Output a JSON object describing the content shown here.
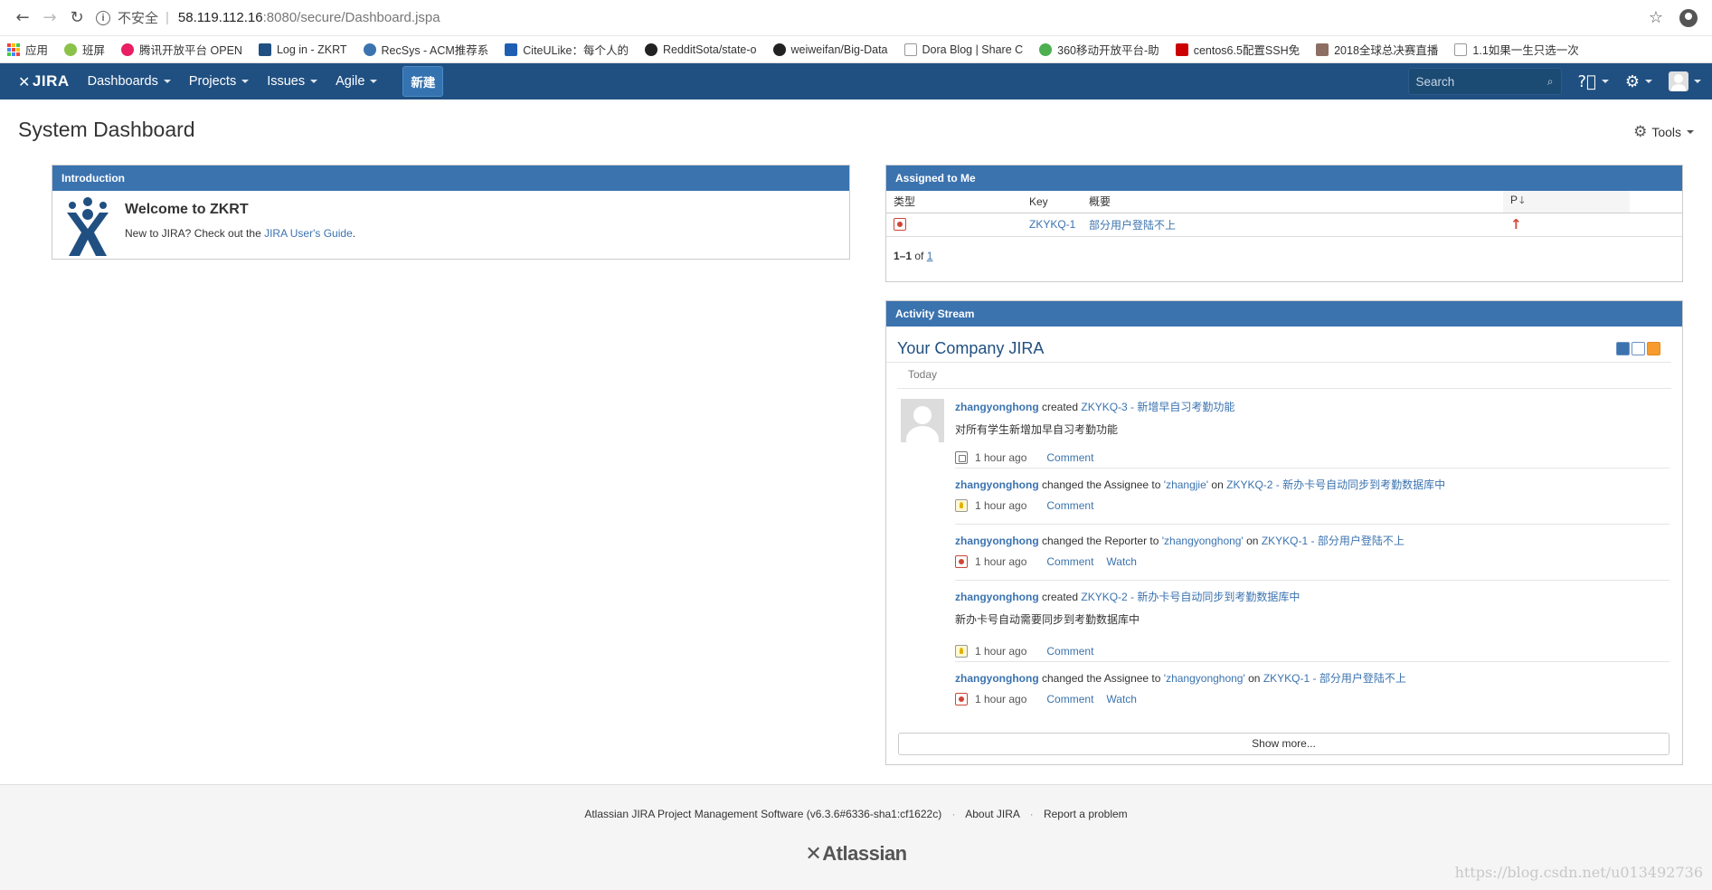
{
  "browser": {
    "insecure_label": "不安全",
    "separator": "|",
    "url_host": "58.119.112.16",
    "url_path": ":8080/secure/Dashboard.jspa",
    "bookmarks": [
      {
        "label": "应用",
        "color": "#e44"
      },
      {
        "label": "班屏",
        "color": "#8bc34a"
      },
      {
        "label": "腾讯开放平台 OPEN",
        "color": "#e91e63"
      },
      {
        "label": "Log in - ZKRT",
        "color": "#205081"
      },
      {
        "label": "RecSys - ACM推荐系",
        "color": "#3b73af"
      },
      {
        "label": "CiteULike：每个人的",
        "color": "#1e5fb4"
      },
      {
        "label": "RedditSota/state-o",
        "color": "#222"
      },
      {
        "label": "weiweifan/Big-Data",
        "color": "#222"
      },
      {
        "label": "Dora Blog | Share C",
        "color": "#999"
      },
      {
        "label": "360移动开放平台-助",
        "color": "#4caf50"
      },
      {
        "label": "centos6.5配置SSH免",
        "color": "#c00"
      },
      {
        "label": "2018全球总决赛直播",
        "color": "#8d6e63"
      },
      {
        "label": "1.1如果一生只选一次",
        "color": "#999"
      }
    ]
  },
  "header": {
    "logo": "JIRA",
    "nav": [
      "Dashboards",
      "Projects",
      "Issues",
      "Agile"
    ],
    "create_label": "新建",
    "search_placeholder": "Search"
  },
  "page": {
    "title": "System Dashboard",
    "tools_label": "Tools"
  },
  "introduction": {
    "title": "Introduction",
    "heading": "Welcome to ZKRT",
    "text_prefix": "New to JIRA? Check out the ",
    "link": "JIRA User's Guide",
    "text_suffix": "."
  },
  "assigned": {
    "title": "Assigned to Me",
    "columns": {
      "type": "类型",
      "key": "Key",
      "summary": "概要",
      "priority": "P"
    },
    "rows": [
      {
        "key": "ZKYKQ-1",
        "summary": "部分用户登陆不上"
      }
    ],
    "pager_range": "1–1",
    "pager_of": "of",
    "pager_page": "1"
  },
  "activity": {
    "title": "Activity Stream",
    "stream_heading": "Your Company JIRA",
    "today": "Today",
    "entries": [
      {
        "user": "zhangyonghong",
        "action": "created",
        "target": "ZKYKQ-3 - 新增早自习考勤功能",
        "description": "对所有学生新增加早自习考勤功能",
        "time": "1 hour ago",
        "comment": "Comment"
      },
      {
        "user": "zhangyonghong",
        "action": "changed the Assignee to",
        "value": "'zhangjie'",
        "on": "on",
        "target": "ZKYKQ-2 - 新办卡号自动同步到考勤数据库中",
        "time": "1 hour ago",
        "comment": "Comment"
      },
      {
        "user": "zhangyonghong",
        "action": "changed the Reporter to",
        "value": "'zhangyonghong'",
        "on": "on",
        "target": "ZKYKQ-1 - 部分用户登陆不上",
        "time": "1 hour ago",
        "comment": "Comment",
        "watch": "Watch"
      },
      {
        "user": "zhangyonghong",
        "action": "created",
        "target": "ZKYKQ-2 - 新办卡号自动同步到考勤数据库中",
        "description": "新办卡号自动需要同步到考勤数据库中",
        "time": "1 hour ago",
        "comment": "Comment"
      },
      {
        "user": "zhangyonghong",
        "action": "changed the Assignee to",
        "value": "'zhangyonghong'",
        "on": "on",
        "target": "ZKYKQ-1 - 部分用户登陆不上",
        "time": "1 hour ago",
        "comment": "Comment",
        "watch": "Watch"
      }
    ],
    "show_more": "Show more..."
  },
  "footer": {
    "software": "Atlassian JIRA Project Management Software (v6.3.6#6336-sha1:cf1622c)",
    "dot": "·",
    "about": "About JIRA",
    "report": "Report a problem",
    "logo": "Atlassian"
  },
  "watermark": "https://blog.csdn.net/u013492736",
  "colors": {
    "header": "#205081",
    "gadget_title": "#3b73af",
    "link": "#3b73af",
    "bug": "#d04437"
  }
}
